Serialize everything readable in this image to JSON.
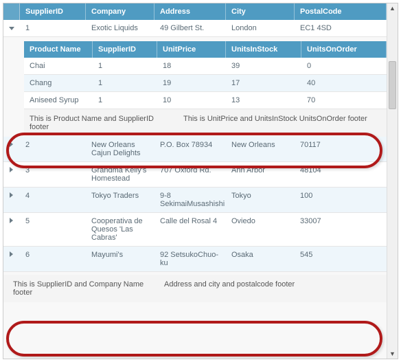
{
  "master_headers": {
    "supplier_id": "SupplierID",
    "company": "Company",
    "address": "Address",
    "city": "City",
    "postal": "PostalCode"
  },
  "detail_headers": {
    "product": "Product Name",
    "supplier_id": "SupplierID",
    "unit_price": "UnitPrice",
    "in_stock": "UnitsInStock",
    "on_order": "UnitsOnOrder"
  },
  "rows": [
    {
      "id": "1",
      "company": "Exotic Liquids",
      "address": "49 Gilbert St.",
      "city": "London",
      "postal": "EC1 4SD",
      "expanded": true
    },
    {
      "id": "2",
      "company": "New Orleans Cajun Delights",
      "address": "P.O. Box 78934",
      "city": "New Orleans",
      "postal": "70117"
    },
    {
      "id": "3",
      "company": "Grandma Kelly's Homestead",
      "address": "707 Oxford Rd.",
      "city": "Ann Arbor",
      "postal": "48104"
    },
    {
      "id": "4",
      "company": "Tokyo Traders",
      "address": "9-8 SekimaiMusashishi",
      "city": "Tokyo",
      "postal": "100"
    },
    {
      "id": "5",
      "company": "Cooperativa de Quesos 'Las Cabras'",
      "address": "Calle del Rosal 4",
      "city": "Oviedo",
      "postal": "33007"
    },
    {
      "id": "6",
      "company": "Mayumi's",
      "address": "92 SetsukoChuo-ku",
      "city": "Osaka",
      "postal": "545"
    }
  ],
  "details": [
    {
      "product": "Chai",
      "sid": "1",
      "price": "18",
      "stock": "39",
      "order": "0"
    },
    {
      "product": "Chang",
      "sid": "1",
      "price": "19",
      "stock": "17",
      "order": "40"
    },
    {
      "product": "Aniseed Syrup",
      "sid": "1",
      "price": "10",
      "stock": "13",
      "order": "70"
    }
  ],
  "detail_footer": {
    "a": "This is Product Name and SupplierID footer",
    "b": "This is UnitPrice and UnitsInStock UnitsOnOrder footer"
  },
  "master_footer": {
    "a": "This is SupplierID and Company Name footer",
    "b": "Address and city and postalcode footer"
  }
}
